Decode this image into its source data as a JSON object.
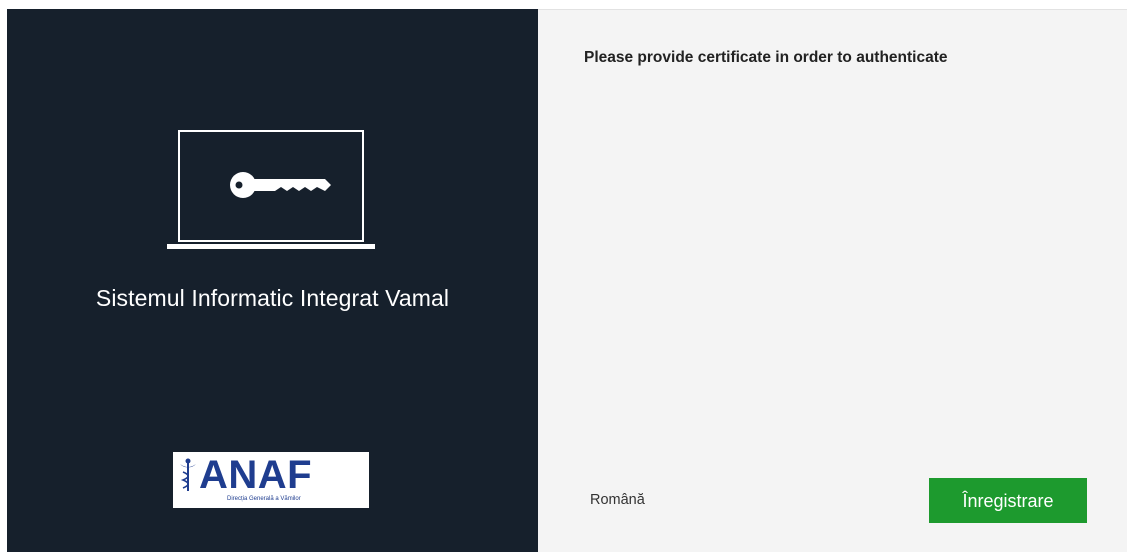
{
  "left_panel": {
    "app_title": "Sistemul Informatic Integrat Vamal",
    "logo": {
      "brand": "ANAF",
      "subtitle": "Direcția Generală a Vămilor"
    },
    "illustration": "laptop-key-icon"
  },
  "right_panel": {
    "prompt": "Please provide certificate in order to authenticate",
    "language_label": "Română",
    "register_button": "Înregistrare"
  },
  "colors": {
    "left_bg": "#16202c",
    "right_bg": "#f4f4f4",
    "button_green": "#1d9a2e",
    "logo_blue": "#1f3d8f"
  }
}
